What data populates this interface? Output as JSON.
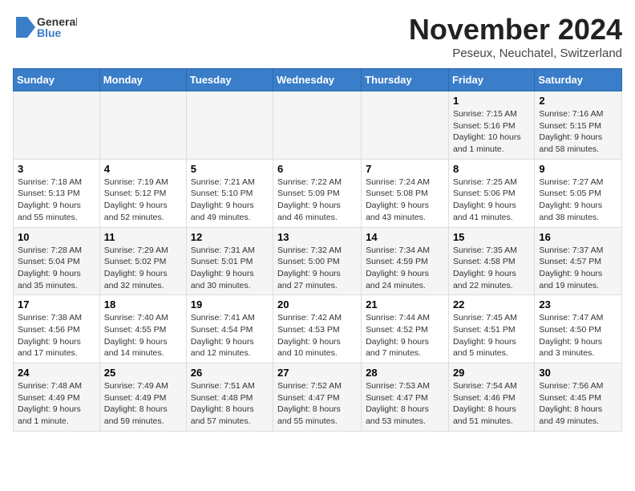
{
  "logo": {
    "text_general": "General",
    "text_blue": "Blue"
  },
  "title": "November 2024",
  "location": "Peseux, Neuchatel, Switzerland",
  "days_of_week": [
    "Sunday",
    "Monday",
    "Tuesday",
    "Wednesday",
    "Thursday",
    "Friday",
    "Saturday"
  ],
  "weeks": [
    [
      {
        "day": "",
        "info": ""
      },
      {
        "day": "",
        "info": ""
      },
      {
        "day": "",
        "info": ""
      },
      {
        "day": "",
        "info": ""
      },
      {
        "day": "",
        "info": ""
      },
      {
        "day": "1",
        "info": "Sunrise: 7:15 AM\nSunset: 5:16 PM\nDaylight: 10 hours and 1 minute."
      },
      {
        "day": "2",
        "info": "Sunrise: 7:16 AM\nSunset: 5:15 PM\nDaylight: 9 hours and 58 minutes."
      }
    ],
    [
      {
        "day": "3",
        "info": "Sunrise: 7:18 AM\nSunset: 5:13 PM\nDaylight: 9 hours and 55 minutes."
      },
      {
        "day": "4",
        "info": "Sunrise: 7:19 AM\nSunset: 5:12 PM\nDaylight: 9 hours and 52 minutes."
      },
      {
        "day": "5",
        "info": "Sunrise: 7:21 AM\nSunset: 5:10 PM\nDaylight: 9 hours and 49 minutes."
      },
      {
        "day": "6",
        "info": "Sunrise: 7:22 AM\nSunset: 5:09 PM\nDaylight: 9 hours and 46 minutes."
      },
      {
        "day": "7",
        "info": "Sunrise: 7:24 AM\nSunset: 5:08 PM\nDaylight: 9 hours and 43 minutes."
      },
      {
        "day": "8",
        "info": "Sunrise: 7:25 AM\nSunset: 5:06 PM\nDaylight: 9 hours and 41 minutes."
      },
      {
        "day": "9",
        "info": "Sunrise: 7:27 AM\nSunset: 5:05 PM\nDaylight: 9 hours and 38 minutes."
      }
    ],
    [
      {
        "day": "10",
        "info": "Sunrise: 7:28 AM\nSunset: 5:04 PM\nDaylight: 9 hours and 35 minutes."
      },
      {
        "day": "11",
        "info": "Sunrise: 7:29 AM\nSunset: 5:02 PM\nDaylight: 9 hours and 32 minutes."
      },
      {
        "day": "12",
        "info": "Sunrise: 7:31 AM\nSunset: 5:01 PM\nDaylight: 9 hours and 30 minutes."
      },
      {
        "day": "13",
        "info": "Sunrise: 7:32 AM\nSunset: 5:00 PM\nDaylight: 9 hours and 27 minutes."
      },
      {
        "day": "14",
        "info": "Sunrise: 7:34 AM\nSunset: 4:59 PM\nDaylight: 9 hours and 24 minutes."
      },
      {
        "day": "15",
        "info": "Sunrise: 7:35 AM\nSunset: 4:58 PM\nDaylight: 9 hours and 22 minutes."
      },
      {
        "day": "16",
        "info": "Sunrise: 7:37 AM\nSunset: 4:57 PM\nDaylight: 9 hours and 19 minutes."
      }
    ],
    [
      {
        "day": "17",
        "info": "Sunrise: 7:38 AM\nSunset: 4:56 PM\nDaylight: 9 hours and 17 minutes."
      },
      {
        "day": "18",
        "info": "Sunrise: 7:40 AM\nSunset: 4:55 PM\nDaylight: 9 hours and 14 minutes."
      },
      {
        "day": "19",
        "info": "Sunrise: 7:41 AM\nSunset: 4:54 PM\nDaylight: 9 hours and 12 minutes."
      },
      {
        "day": "20",
        "info": "Sunrise: 7:42 AM\nSunset: 4:53 PM\nDaylight: 9 hours and 10 minutes."
      },
      {
        "day": "21",
        "info": "Sunrise: 7:44 AM\nSunset: 4:52 PM\nDaylight: 9 hours and 7 minutes."
      },
      {
        "day": "22",
        "info": "Sunrise: 7:45 AM\nSunset: 4:51 PM\nDaylight: 9 hours and 5 minutes."
      },
      {
        "day": "23",
        "info": "Sunrise: 7:47 AM\nSunset: 4:50 PM\nDaylight: 9 hours and 3 minutes."
      }
    ],
    [
      {
        "day": "24",
        "info": "Sunrise: 7:48 AM\nSunset: 4:49 PM\nDaylight: 9 hours and 1 minute."
      },
      {
        "day": "25",
        "info": "Sunrise: 7:49 AM\nSunset: 4:49 PM\nDaylight: 8 hours and 59 minutes."
      },
      {
        "day": "26",
        "info": "Sunrise: 7:51 AM\nSunset: 4:48 PM\nDaylight: 8 hours and 57 minutes."
      },
      {
        "day": "27",
        "info": "Sunrise: 7:52 AM\nSunset: 4:47 PM\nDaylight: 8 hours and 55 minutes."
      },
      {
        "day": "28",
        "info": "Sunrise: 7:53 AM\nSunset: 4:47 PM\nDaylight: 8 hours and 53 minutes."
      },
      {
        "day": "29",
        "info": "Sunrise: 7:54 AM\nSunset: 4:46 PM\nDaylight: 8 hours and 51 minutes."
      },
      {
        "day": "30",
        "info": "Sunrise: 7:56 AM\nSunset: 4:45 PM\nDaylight: 8 hours and 49 minutes."
      }
    ]
  ]
}
